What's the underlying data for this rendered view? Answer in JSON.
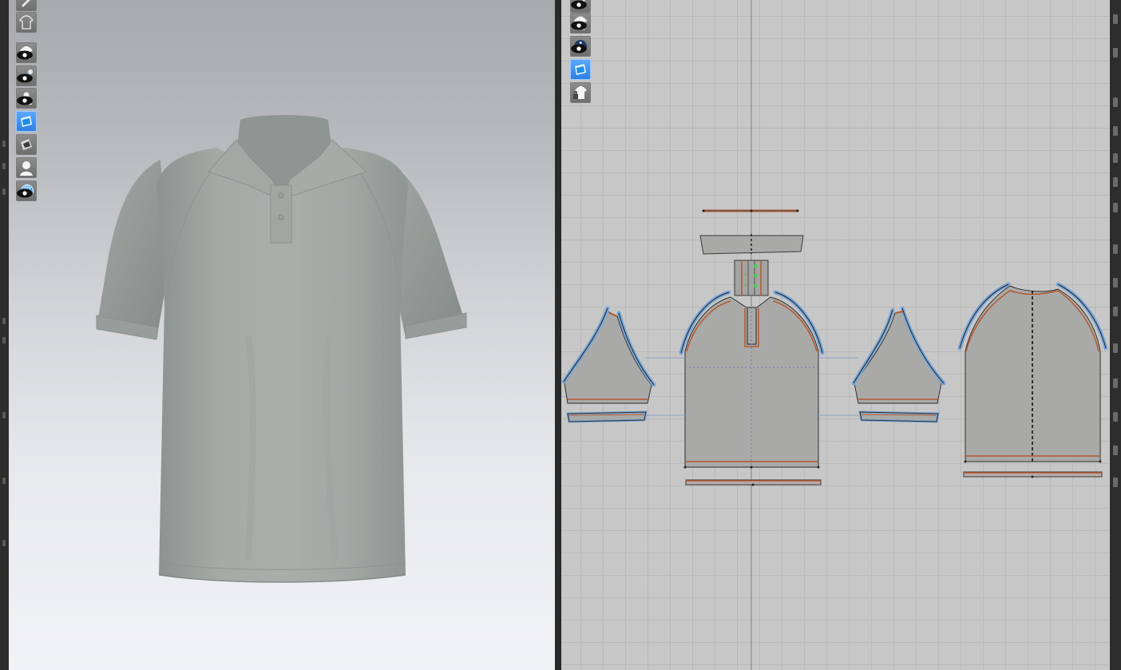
{
  "app": {
    "name": "",
    "accent_color": "#2f7fe0",
    "pattern_line_colors": {
      "seam_outline": "#7aa7d8",
      "stitch": "#b5582f",
      "notch_dashed": "#101010",
      "fabric": "#a9aaa8"
    }
  },
  "viewport_3d": {
    "background": "gradient-grey-to-white",
    "garment": "polo-shirt",
    "garment_color": "#a3a8a5",
    "toolbar": [
      {
        "icon": "pencil-icon",
        "visible_eye": false,
        "active": false
      },
      {
        "icon": "tshirt-outline-icon",
        "visible_eye": false,
        "active": false
      },
      {
        "icon": "show-garment-icon",
        "visible_eye": true,
        "active": false
      },
      {
        "icon": "show-pins-icon",
        "visible_eye": true,
        "active": false
      },
      {
        "icon": "show-avatar-icon",
        "visible_eye": true,
        "active": false
      },
      {
        "icon": "texture-view-icon",
        "visible_eye": false,
        "active": true
      },
      {
        "icon": "surface-shader-icon",
        "visible_eye": false,
        "active": false
      },
      {
        "icon": "avatar-silhouette-icon",
        "visible_eye": false,
        "active": false
      },
      {
        "icon": "globe-grid-icon",
        "visible_eye": true,
        "active": false
      }
    ]
  },
  "viewport_2d": {
    "background": "#c7c7c7",
    "toolbar": [
      {
        "icon": "pencil-icon",
        "visible_eye": true
      },
      {
        "icon": "tshirt-outline-icon",
        "visible_eye": true
      },
      {
        "icon": "info-icon",
        "visible_eye": true
      },
      {
        "icon": "fabric-view-icon",
        "visible_eye": false,
        "active": true
      },
      {
        "icon": "lock-garment-icon",
        "visible_eye": false
      }
    ],
    "pattern_pieces": [
      "collar-band",
      "collar",
      "placket",
      "front-body",
      "back-body",
      "left-sleeve",
      "right-sleeve",
      "left-sleeve-cuff",
      "right-sleeve-cuff",
      "front-hem-band",
      "back-hem-band"
    ]
  }
}
